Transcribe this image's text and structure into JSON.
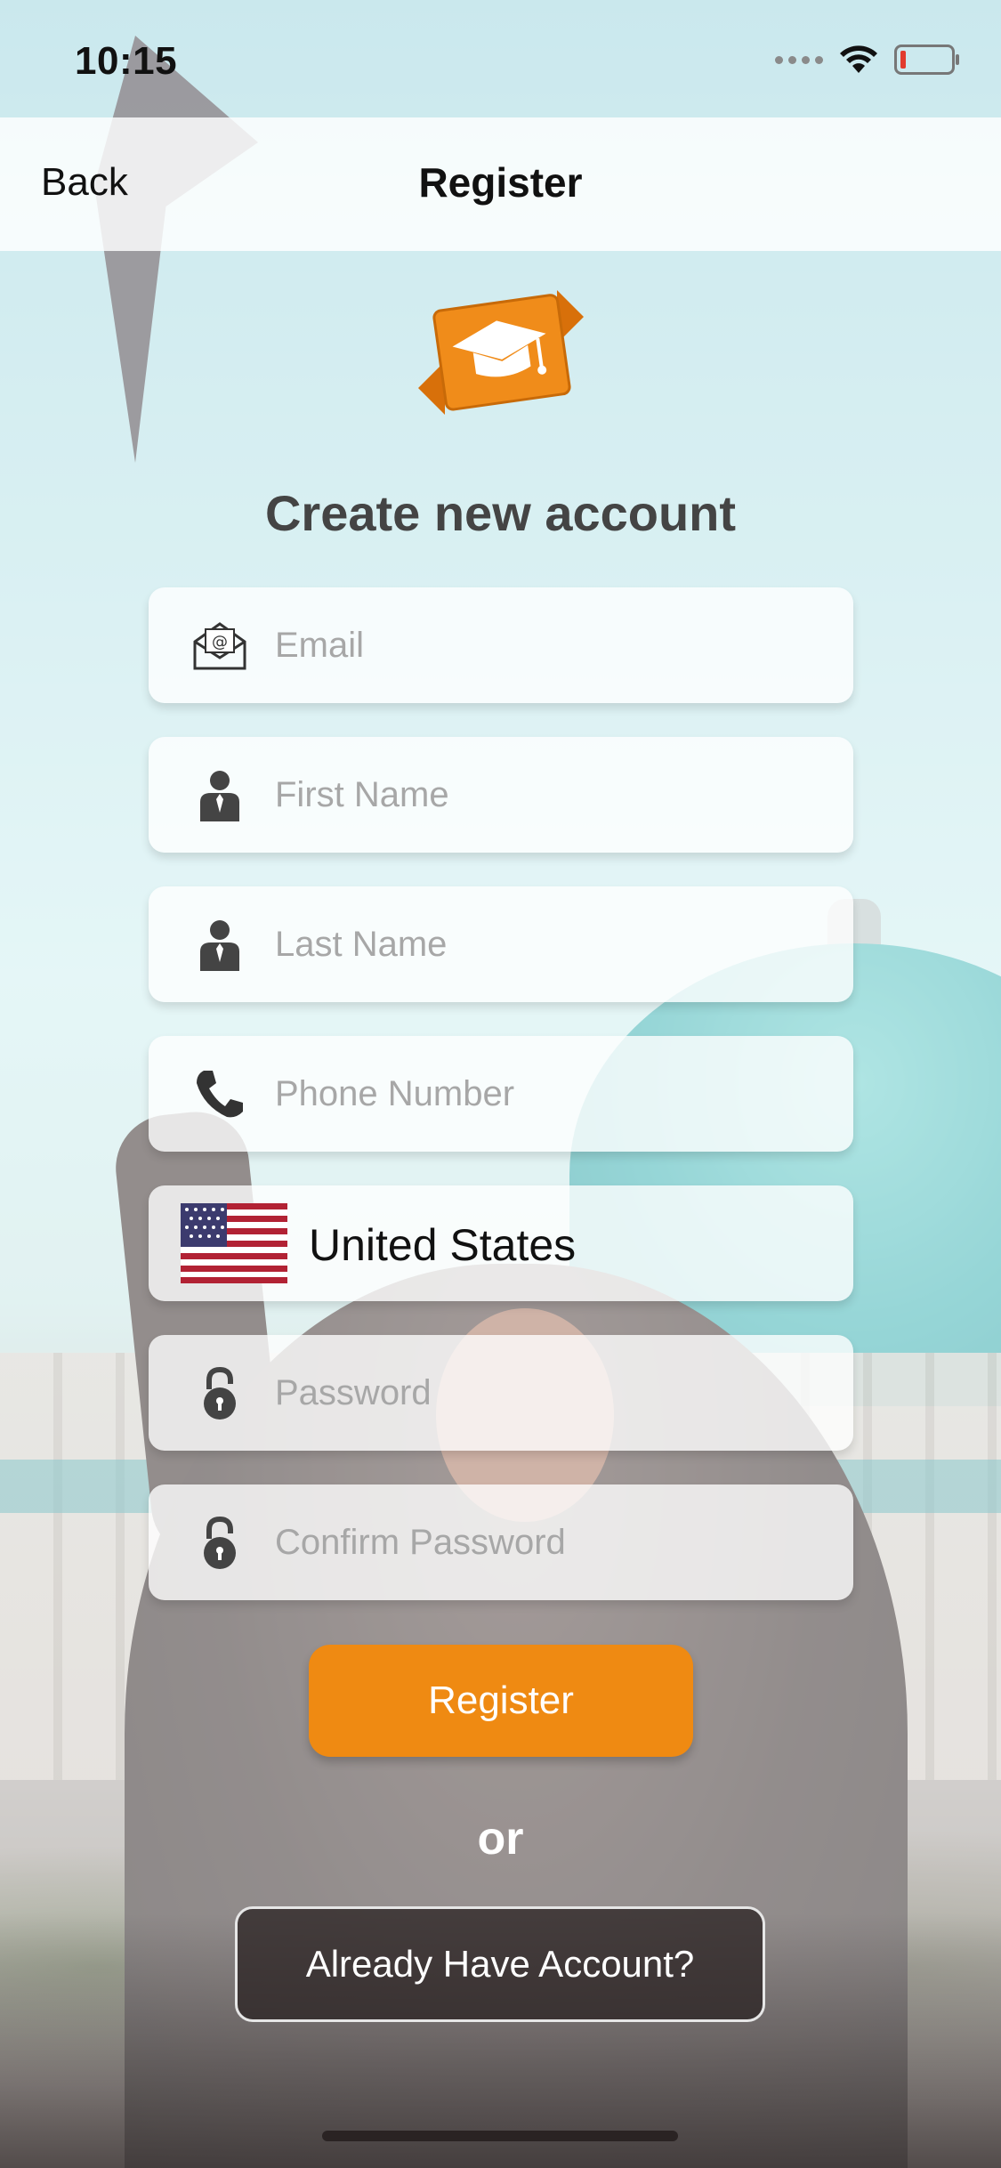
{
  "status_bar": {
    "time": "10:15",
    "icons": [
      "cellular-dots-icon",
      "wifi-icon",
      "battery-low-icon"
    ]
  },
  "navbar": {
    "back_label": "Back",
    "title": "Register"
  },
  "logo": {
    "icon": "graduation-cap-logo-icon",
    "color": "#F08C1A"
  },
  "heading": "Create new account",
  "form": {
    "email": {
      "placeholder": "Email",
      "icon": "envelope-icon"
    },
    "first_name": {
      "placeholder": "First Name",
      "icon": "person-icon"
    },
    "last_name": {
      "placeholder": "Last Name",
      "icon": "person-icon"
    },
    "phone": {
      "placeholder": "Phone Number",
      "icon": "phone-icon"
    },
    "country": {
      "value": "United States",
      "icon": "us-flag-icon"
    },
    "password": {
      "placeholder": "Password",
      "icon": "padlock-icon"
    },
    "confirm_password": {
      "placeholder": "Confirm Password",
      "icon": "padlock-icon"
    }
  },
  "actions": {
    "register_label": "Register",
    "or_label": "or",
    "login_label": "Already Have Account?"
  },
  "colors": {
    "accent": "#EF8A12",
    "heading": "#444444",
    "placeholder": "#A7A7A7"
  }
}
